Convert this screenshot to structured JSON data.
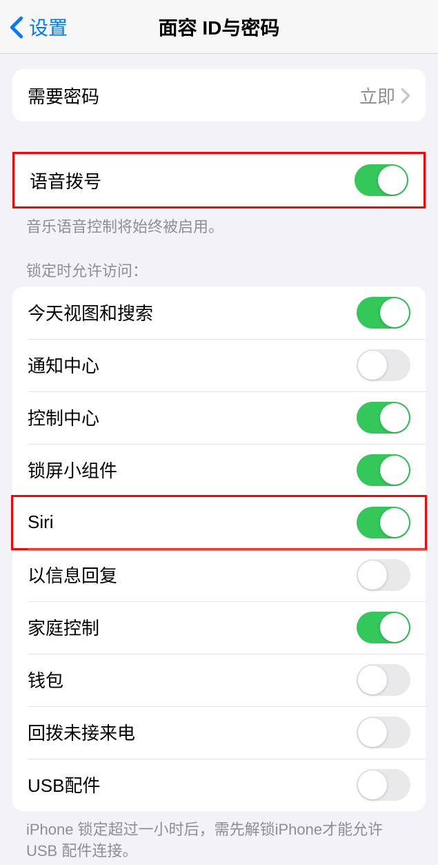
{
  "header": {
    "back_label": "设置",
    "title": "面容 ID与密码"
  },
  "require_passcode": {
    "label": "需要密码",
    "value": "立即"
  },
  "voice_dial": {
    "label": "语音拨号",
    "footer": "音乐语音控制将始终被启用。"
  },
  "locked_access": {
    "header": "锁定时允许访问：",
    "items": [
      {
        "label": "今天视图和搜索",
        "on": true
      },
      {
        "label": "通知中心",
        "on": false
      },
      {
        "label": "控制中心",
        "on": true
      },
      {
        "label": "锁屏小组件",
        "on": true
      },
      {
        "label": "Siri",
        "on": true
      },
      {
        "label": "以信息回复",
        "on": false
      },
      {
        "label": "家庭控制",
        "on": true
      },
      {
        "label": "钱包",
        "on": false
      },
      {
        "label": "回拨未接来电",
        "on": false
      },
      {
        "label": "USB配件",
        "on": false
      }
    ],
    "footer": "iPhone 锁定超过一小时后，需先解锁iPhone才能允许 USB 配件连接。"
  }
}
